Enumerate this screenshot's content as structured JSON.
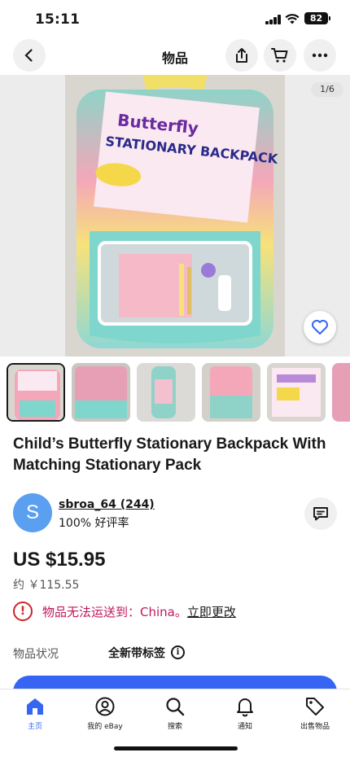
{
  "status": {
    "time": "15:11",
    "battery": "82"
  },
  "header": {
    "title": "物品"
  },
  "gallery": {
    "counter": "1/6"
  },
  "item": {
    "title": "Child’s Butterfly Stationary Backpack With Matching Stationary Pack"
  },
  "seller": {
    "avatar_letter": "S",
    "name": "sbroa_64",
    "feedback_count": "(244)",
    "rating": "100% 好评率"
  },
  "price": {
    "main": "US $15.95",
    "approx": "约 ￥115.55"
  },
  "shipping": {
    "notice": "物品无法运送到：China。",
    "change_link": "立即更改"
  },
  "condition": {
    "label": "物品状况",
    "value": "全新带标签"
  },
  "bottom_nav": [
    {
      "label": "主页",
      "icon": "home-icon",
      "active": true
    },
    {
      "label": "我的 eBay",
      "icon": "user-icon",
      "active": false
    },
    {
      "label": "搜索",
      "icon": "search-icon",
      "active": false
    },
    {
      "label": "通知",
      "icon": "bell-icon",
      "active": false
    },
    {
      "label": "出售物品",
      "icon": "tag-icon",
      "active": false
    }
  ],
  "colors": {
    "accent": "#3665f3",
    "alert": "#d0232b",
    "ship_text": "#c0175a"
  }
}
